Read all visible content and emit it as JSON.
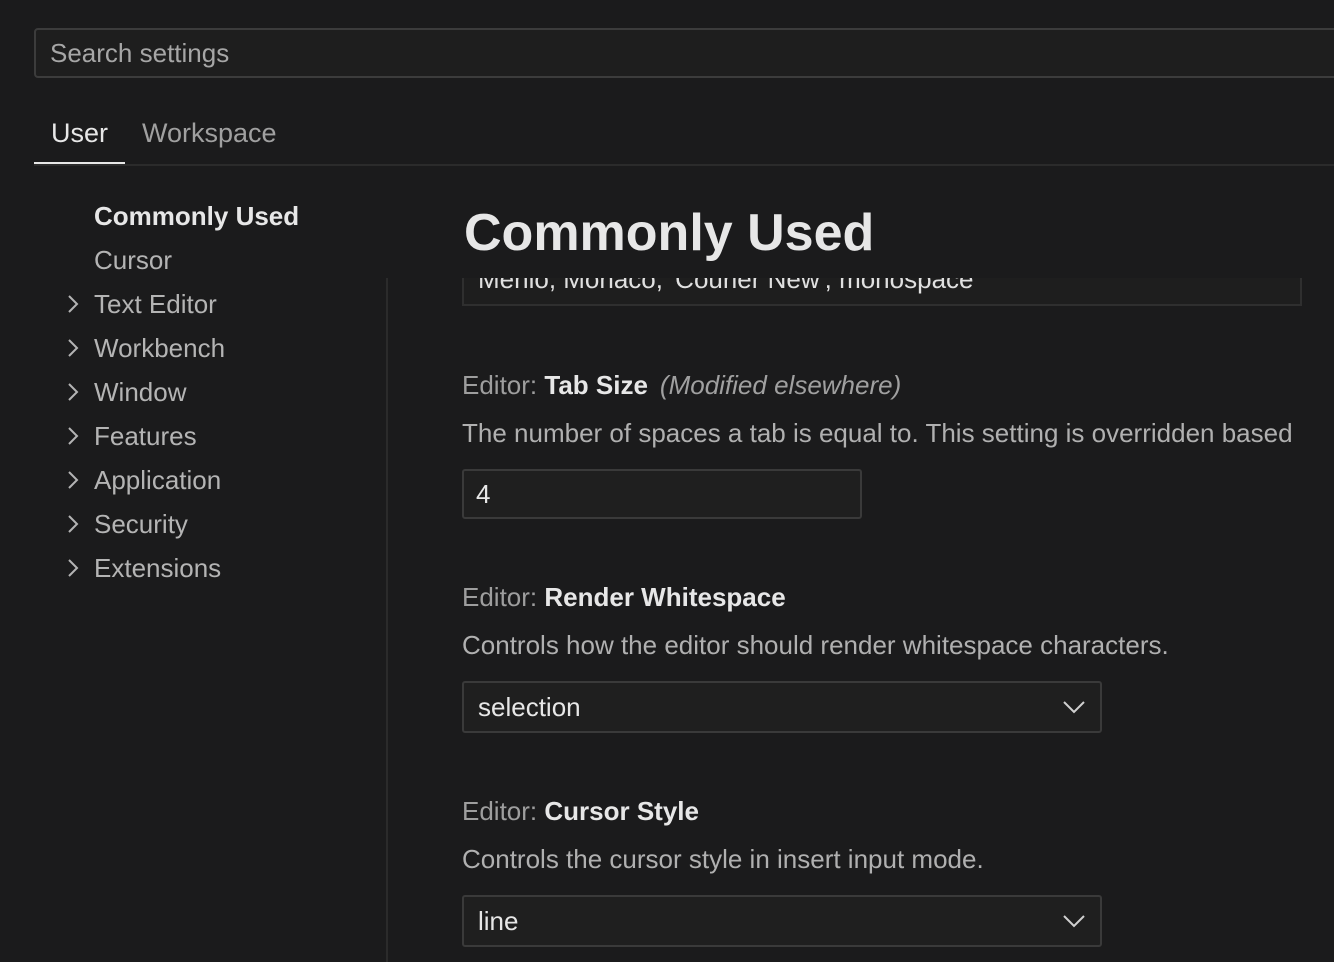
{
  "search": {
    "placeholder": "Search settings"
  },
  "tabs": [
    {
      "label": "User",
      "active": true
    },
    {
      "label": "Workspace",
      "active": false
    }
  ],
  "tree": {
    "items": [
      {
        "label": "Commonly Used",
        "expandable": false,
        "selected": true
      },
      {
        "label": "Cursor",
        "expandable": false
      },
      {
        "label": "Text Editor",
        "expandable": true
      },
      {
        "label": "Workbench",
        "expandable": true
      },
      {
        "label": "Window",
        "expandable": true
      },
      {
        "label": "Features",
        "expandable": true
      },
      {
        "label": "Application",
        "expandable": true
      },
      {
        "label": "Security",
        "expandable": true
      },
      {
        "label": "Extensions",
        "expandable": true
      }
    ]
  },
  "main": {
    "section_title": "Commonly Used",
    "font_family_value": "Menlo, Monaco, 'Courier New', monospace",
    "settings": [
      {
        "prefix": "Editor: ",
        "name": "Tab Size",
        "modified": "(Modified elsewhere)",
        "description": "The number of spaces a tab is equal to. This setting is overridden based",
        "value": "4"
      },
      {
        "prefix": "Editor: ",
        "name": "Render Whitespace",
        "description": "Controls how the editor should render whitespace characters.",
        "value": "selection"
      },
      {
        "prefix": "Editor: ",
        "name": "Cursor Style",
        "description": "Controls the cursor style in insert input mode.",
        "value": "line"
      }
    ]
  },
  "icons": {
    "tree_chevron": "chevron-right-icon",
    "dropdown": "chevron-down-icon"
  }
}
